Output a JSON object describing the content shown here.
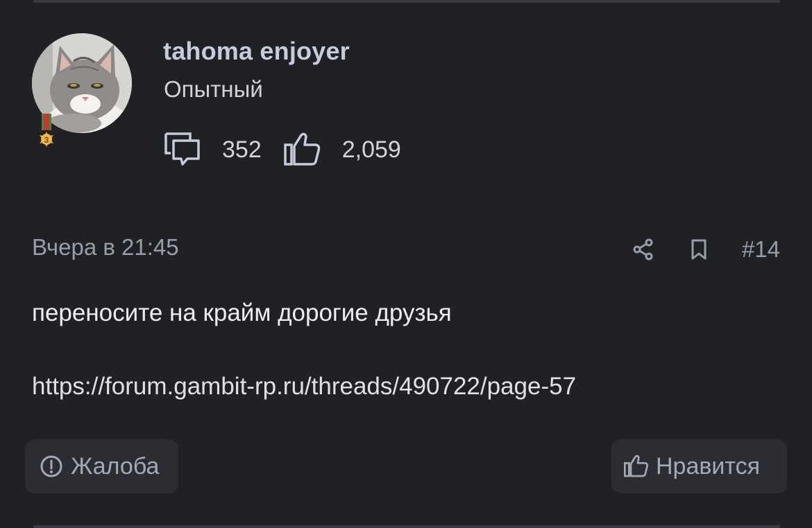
{
  "user": {
    "name": "tahoma enjoyer",
    "rank": "Опытный",
    "avatar": "cat-avatar",
    "medal_level": "3",
    "stats": {
      "messages_icon": "messages-icon",
      "messages_count": "352",
      "likes_icon": "thumbs-up-icon",
      "likes_count": "2,059"
    }
  },
  "post": {
    "date": "Вчера в 21:45",
    "number": "#14",
    "share_icon": "share-icon",
    "bookmark_icon": "bookmark-icon",
    "text": "переносите на крайм дорогие друзья",
    "link": "https://forum.gambit-rp.ru/threads/490722/page-57"
  },
  "actions": {
    "report_icon": "alert-circle-icon",
    "report_label": "Жалоба",
    "like_icon": "thumbs-up-icon",
    "like_label": "Нравится"
  },
  "colors": {
    "background": "#202125",
    "button_bg": "#2c2d33",
    "username": "#c7cbda",
    "muted_text": "#9a9ca8",
    "medal_gold": "#e2a43a",
    "ribbon_red": "#c9342d",
    "ribbon_green": "#3d8a3a"
  }
}
